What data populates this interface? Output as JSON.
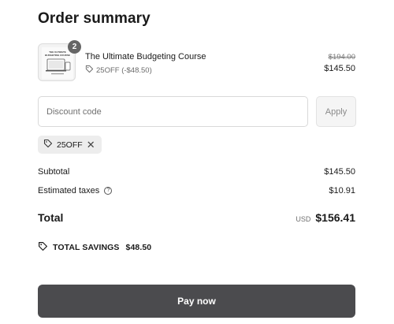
{
  "header": {
    "title": "Order summary"
  },
  "product": {
    "quantity": "2",
    "thumbnail_text": "THE ULTIMATE BUDGETING COURSE",
    "name": "The Ultimate Budgeting Course",
    "discount_text": "25OFF (-$48.50)",
    "original_price": "$194.00",
    "price": "$145.50"
  },
  "discount": {
    "placeholder": "Discount code",
    "apply_label": "Apply",
    "applied_code": "25OFF"
  },
  "summary": {
    "subtotal_label": "Subtotal",
    "subtotal_value": "$145.50",
    "taxes_label": "Estimated taxes",
    "taxes_value": "$10.91",
    "total_label": "Total",
    "currency": "USD",
    "total_value": "$156.41",
    "savings_label": "TOTAL SAVINGS",
    "savings_value": "$48.50"
  },
  "pay_button": {
    "label": "Pay now"
  },
  "icons": {
    "tag": "tag-icon",
    "close": "close-icon",
    "help": "help-circle-icon"
  },
  "colors": {
    "pay_button": "#4b4b4e",
    "chip_bg": "#ededed",
    "badge": "#666666"
  }
}
